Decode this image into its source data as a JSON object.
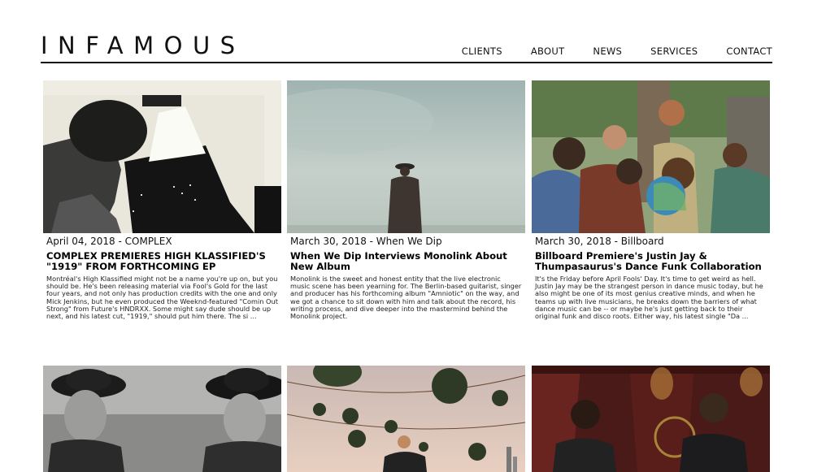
{
  "brand": {
    "logo": "INFAMOUS"
  },
  "nav": [
    "CLIENTS",
    "ABOUT",
    "NEWS",
    "SERVICES",
    "CONTACT"
  ],
  "articles": [
    {
      "meta": "April 04, 2018 - COMPLEX",
      "title": "COMPLEX PREMIERES HIGH KLASSIFIED'S \"1919\" FROM FORTHCOMING EP",
      "excerpt": "Montréal's High Klassified might not be a name you're up on, but you should be. He's been releasing material via Fool's Gold for the last four years, and not only has production credits with the one and only Mick Jenkins, but he even produced the Weeknd-featured \"Comin Out Strong\" from Future's HNDRXX. Some might say dude should be up next, and his latest cut, \"1919,\" should put him there. The si ..."
    },
    {
      "meta": "March 30, 2018 - When We Dip",
      "title": "When We Dip Interviews Monolink About New Album",
      "excerpt": "Monolink is the sweet and honest entity that the live electronic music scene has been yearning for. The Berlin-based guitarist, singer and producer has his forthcoming album \"Amniotic\" on the way, and we got a chance to sit down with him and talk about the record, his writing process, and dive deeper into the mastermind behind the Monolink project."
    },
    {
      "meta": "March 30, 2018 - Billboard",
      "title": "Billboard Premiere's Justin Jay & Thumpasaurus's Dance Funk Collaboration",
      "excerpt": "It's the Friday before April Fools' Day. It's time to get weird as hell. Justin Jay may be the strangest person in dance music today, but he also might be one of its most genius creative minds, and when he teams up with live musicians, he breaks down the barriers of what dance music can be -- or maybe he's just getting back to their original funk and disco roots. Either way, his latest single \"Da ..."
    }
  ],
  "colors": {
    "text": "#111111",
    "rule": "#111111",
    "background": "#ffffff"
  }
}
